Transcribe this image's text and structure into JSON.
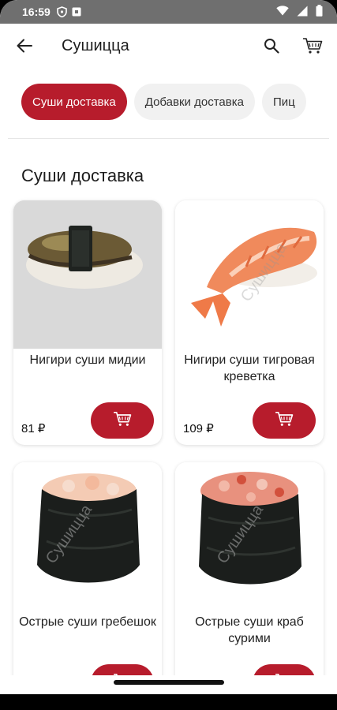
{
  "status_bar": {
    "time": "16:59"
  },
  "app_bar": {
    "title": "Сушицца"
  },
  "chips": [
    {
      "label": "Суши доставка",
      "active": true
    },
    {
      "label": "Добавки доставка",
      "active": false
    },
    {
      "label": "Пиц",
      "active": false
    }
  ],
  "section": {
    "title": "Суши доставка"
  },
  "products": [
    {
      "name": "Нигири суши мидии",
      "price": "81 ₽"
    },
    {
      "name": "Нигири суши тигровая креветка",
      "price": "109 ₽"
    },
    {
      "name": "Острые суши гребешок",
      "price": ""
    },
    {
      "name": "Острые суши краб сурими",
      "price": ""
    }
  ],
  "watermark": "Сушицца",
  "colors": {
    "accent": "#b71c2c",
    "status_bar": "#6f6f6f"
  }
}
